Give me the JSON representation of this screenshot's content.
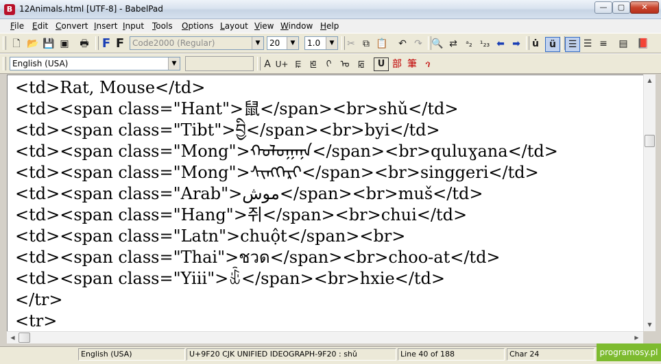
{
  "window": {
    "title": "12Animals.html [UTF-8] - BabelPad",
    "app_icon": "babelpad-icon",
    "min_glyph": "—",
    "max_glyph": "▢",
    "close_glyph": "✕"
  },
  "menu": [
    {
      "u": "F",
      "rest": "ile"
    },
    {
      "u": "E",
      "rest": "dit"
    },
    {
      "u": "C",
      "rest": "onvert"
    },
    {
      "u": "I",
      "rest": "nsert"
    },
    {
      "u": "I",
      "rest": "nput"
    },
    {
      "u": "T",
      "rest": "ools"
    },
    {
      "u": "O",
      "rest": "ptions"
    },
    {
      "u": "L",
      "rest": "ayout"
    },
    {
      "u": "V",
      "rest": "iew"
    },
    {
      "u": "W",
      "rest": "indow"
    },
    {
      "u": "H",
      "rest": "elp"
    }
  ],
  "toolbar": {
    "font_name": "Code2000 (Regular)",
    "font_size": "20",
    "line_spacing": "1.0",
    "bold_f": "F",
    "plain_f": "F",
    "language": "English (USA)"
  },
  "editor": {
    "lines": [
      "<td>Rat, Mouse</td>",
      "<td><span class=\"Hant\">鼠</span><br>shǔ</td>",
      "<td><span class=\"Tibt\">བྱི</span><br>byi</td>",
      "<td><span class=\"Mong\">ᠬᠤᠯᠤᠭᠠᠨᠠ</span><br>quluɣana</td>",
      "<td><span class=\"Mong\">ᠰᠢᠩᠭᠡᠷᠢ</span><br>singgeri</td>",
      "<td><span class=\"Arab\">موش</span><br>muš</td>",
      "<td><span class=\"Hang\">쥐</span><br>chui</td>",
      "<td><span class=\"Latn\">chuột</span><br>",
      "<td><span class=\"Thai\">ชวด</span><br>choo-at</td>",
      "<td><span class=\"Yiii\">ꉝ</span><br>hxie</td>",
      "</tr>",
      "<tr>"
    ]
  },
  "status": {
    "language": "English (USA)",
    "char_info": "U+9F20 CJK UNIFIED IDEOGRAPH-9F20 : shǔ",
    "line": "Line 40 of 188",
    "char": "Char 24"
  },
  "badge": "programosy.pl"
}
